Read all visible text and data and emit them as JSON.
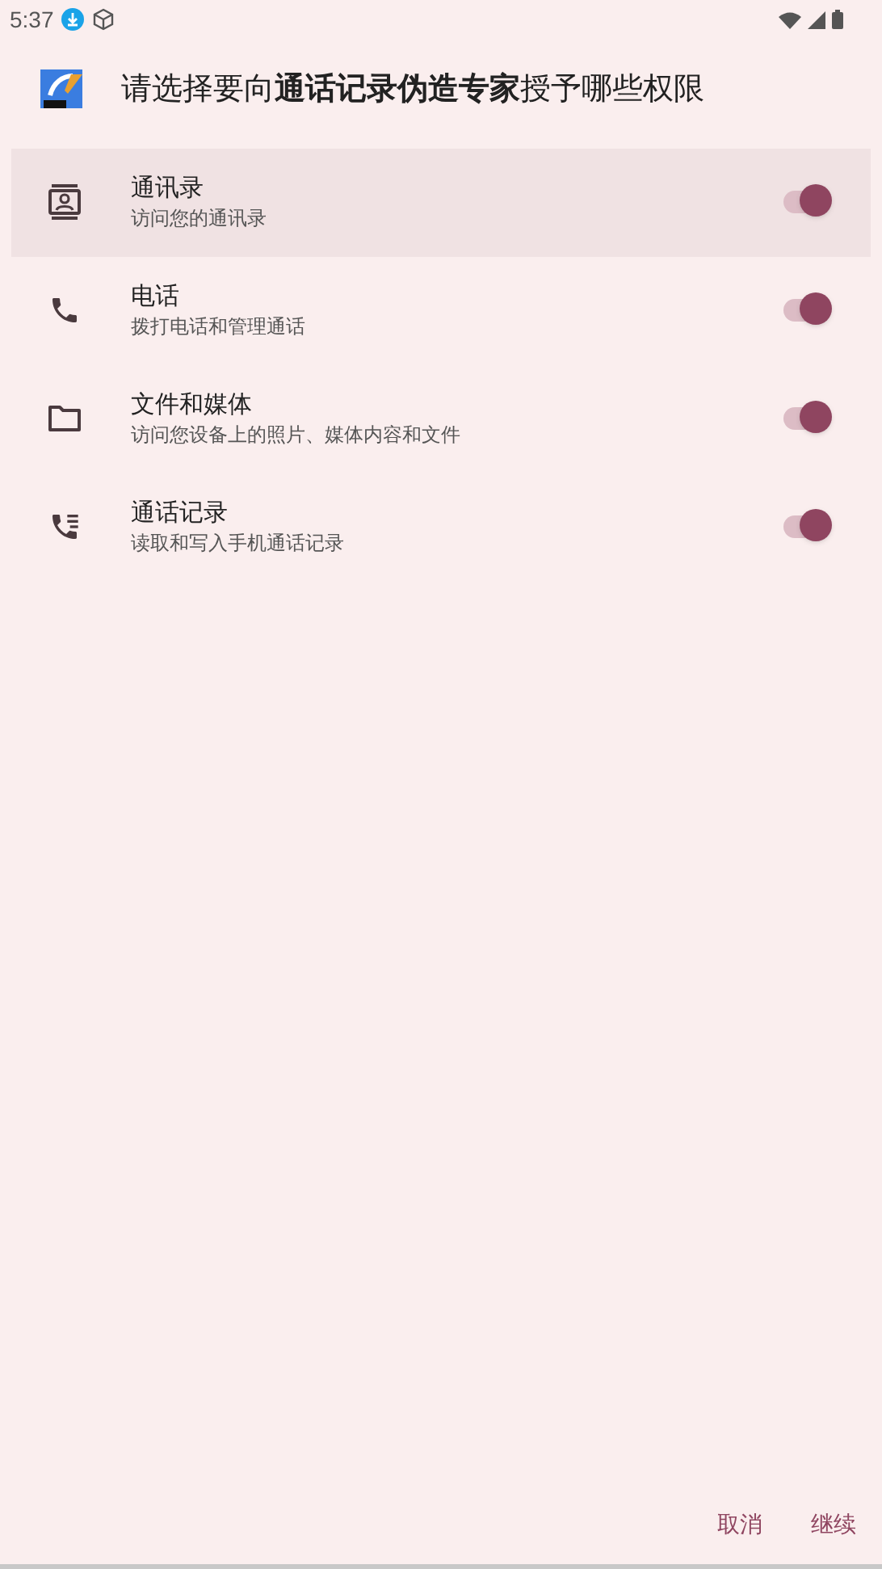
{
  "status_bar": {
    "time": "5:37"
  },
  "title": "请选择要向**通话记录伪造专家**授予哪些权限",
  "permissions": [
    {
      "kind": "contacts",
      "label": "通讯录",
      "description": "访问您的通讯录",
      "on": true,
      "selected": true
    },
    {
      "kind": "phone",
      "label": "电话",
      "description": "拨打电话和管理通话",
      "on": true,
      "selected": false
    },
    {
      "kind": "folder",
      "label": "文件和媒体",
      "description": "访问您设备上的照片、媒体内容和文件",
      "on": true,
      "selected": false
    },
    {
      "kind": "call_log",
      "label": "通话记录",
      "description": "读取和写入手机通话记录",
      "on": true,
      "selected": false
    }
  ],
  "buttons": [
    "取消",
    "继续"
  ]
}
